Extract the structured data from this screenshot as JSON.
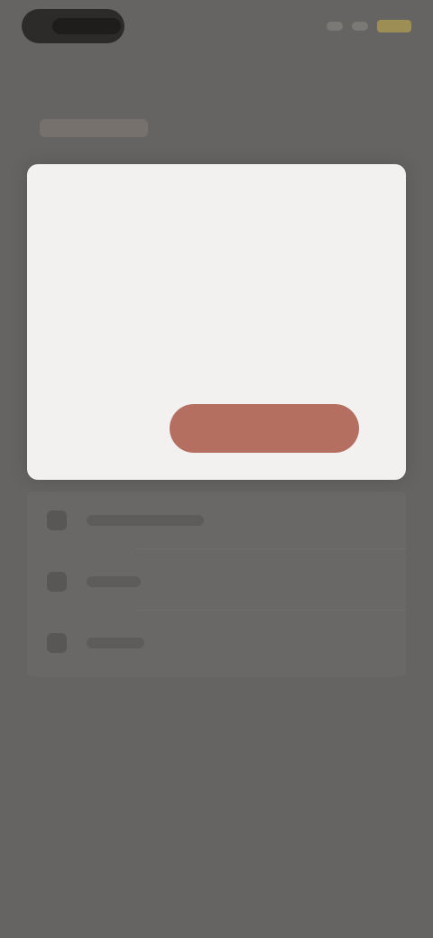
{
  "status_bar": {
    "time": "",
    "colors": {
      "battery": "#9c8e55"
    }
  },
  "header": {
    "title": ""
  },
  "settings_list": {
    "items": [
      {
        "label": "",
        "icon": "lock-icon"
      },
      {
        "label": "",
        "icon": "star-icon"
      },
      {
        "label": "",
        "icon": "help-icon"
      }
    ]
  },
  "dialog": {
    "title": "",
    "message": "",
    "link_text": "",
    "secondary_label": "",
    "primary_label": "",
    "colors": {
      "primary_button": "#b56f61",
      "background": "#f3f1ef"
    }
  }
}
